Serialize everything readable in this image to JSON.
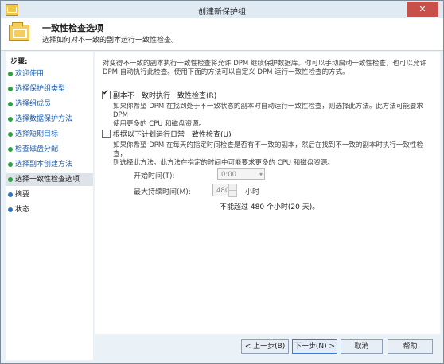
{
  "window": {
    "title": "创建新保护组",
    "close_glyph": "✕"
  },
  "header": {
    "title": "一致性检查选项",
    "subtitle": "选择如何对不一致的副本运行一致性检查。"
  },
  "sidebar": {
    "label": "步骤:",
    "items": [
      {
        "label": "欢迎使用"
      },
      {
        "label": "选择保护组类型"
      },
      {
        "label": "选择组成员"
      },
      {
        "label": "选择数据保护方法"
      },
      {
        "label": "选择短期目标"
      },
      {
        "label": "检查磁盘分配"
      },
      {
        "label": "选择副本创建方法"
      },
      {
        "label": "选择一致性检查选项"
      },
      {
        "label": "摘要"
      },
      {
        "label": "状态"
      }
    ]
  },
  "main": {
    "intro_line1": "对变得不一致的副本执行一致性检查将允许 DPM 继续保护数据库。你可以手动启动一致性检查，也可以允许",
    "intro_line2": "DPM 自动执行此检查。使用下面的方法可以自定义 DPM 运行一致性检查的方式。",
    "option1": {
      "label": "副本不一致时执行一致性检查(R)",
      "checked": true,
      "desc_line1": "如果你希望 DPM 在找到处于不一致状态的副本时自动运行一致性检查，则选择此方法。此方法可能要求 DPM",
      "desc_line2": "使用更多的 CPU 和磁盘资源。"
    },
    "option2": {
      "label": "根据以下计划运行日常一致性检查(U)",
      "checked": false,
      "desc_line1": "如果你希望 DPM 在每天的指定时间检查是否有不一致的副本，然后在找到不一致的副本时执行一致性检查，",
      "desc_line2": "则选择此方法。此方法在指定的时间中可能要求更多的 CPU 和磁盘资源。"
    },
    "start_time_label": "开始时间(T):",
    "start_time_value": "0:00",
    "max_duration_label": "最大持续时间(M):",
    "max_duration_value": "480",
    "max_duration_unit": "小时",
    "duration_note": "不能超过 480 个小时(20 天)。"
  },
  "footer": {
    "back": "< 上一步(B)",
    "next": "下一步(N) >",
    "cancel": "取消",
    "help": "帮助"
  },
  "colors": {
    "accent": "#3b7bd6",
    "link": "#1d5fae",
    "done_bullet": "#2ea043",
    "pending_bullet": "#2e72b8",
    "close_button": "#c7504b"
  }
}
